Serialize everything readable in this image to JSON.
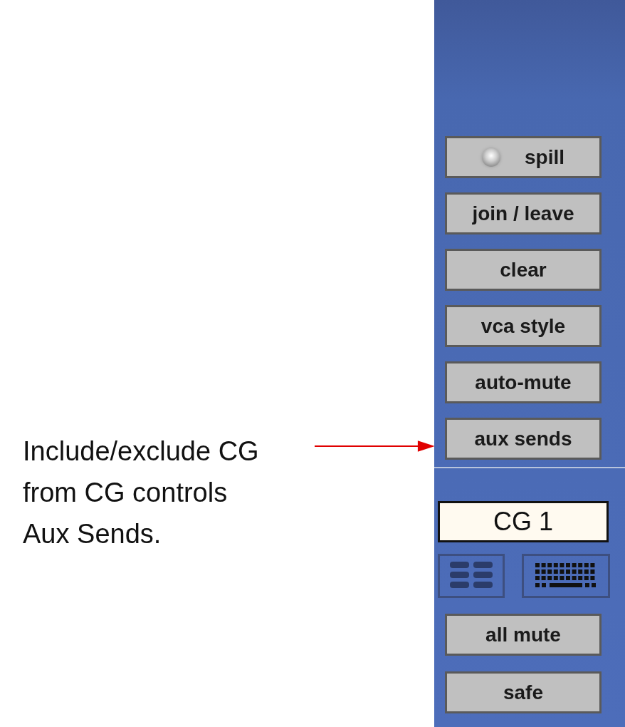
{
  "annotation": {
    "text": "Include/exclude CG\nfrom CG controls\nAux Sends."
  },
  "group_buttons": [
    {
      "label": "spill",
      "kind": "led",
      "lit": false
    },
    {
      "label": "join / leave",
      "kind": "plain"
    },
    {
      "label": "clear",
      "kind": "plain"
    },
    {
      "label": "vca style",
      "kind": "plain"
    },
    {
      "label": "auto-mute",
      "kind": "plain"
    },
    {
      "label": "aux sends",
      "kind": "plain"
    }
  ],
  "group_name": {
    "value": "CG 1"
  },
  "bottom_buttons": [
    {
      "label": "all mute"
    },
    {
      "label": "safe"
    }
  ]
}
